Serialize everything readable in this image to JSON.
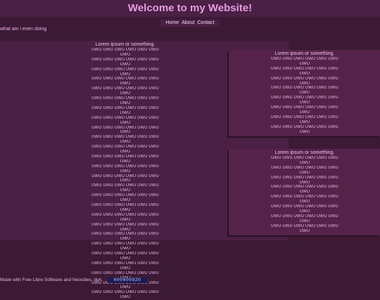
{
  "header": {
    "title": "Welcome to my Website!"
  },
  "nav": {
    "items": [
      "Home",
      "About",
      "Contact"
    ]
  },
  "subline": "what am i even doing",
  "main": {
    "title": "Lorem ipsum or something.",
    "rows": [
      "UWU UWU UWU UWU UWU UWU UWU",
      "UWU UWU UWU UWU UWU UWU UWU",
      "UWU UWU UWU UWU UWU UWU UWU",
      "UWU UWU UWU UWU UWU UWU UWU",
      "UWU UWU UWU UWU UWU UWU UWU",
      "UWU UWU UWU UWU UWU UWU UWU",
      "UWU UWU UWU UWU UWU UWU UWU",
      "UWU UWU UWU UWU UWU UWU UWU",
      "UWU UWU UWU UWU UWU UWU UWU",
      "UWU UWU UWU UWU UWU UWU UWU",
      "UWU UWU UWU UWU UWU UWU UWU",
      "UWU UWU UWU UWU UWU UWU UWU",
      "UWU UWU UWU UWU UWU UWU UWU",
      "UWU UWU UWU UWU UWU UWU UWU",
      "UWU UWU UWU UWU UWU UWU UWU",
      "UWU UWU UWU UWU UWU UWU UWU",
      "UWU UWU UWU UWU UWU UWU UWU",
      "UWU UWU UWU UWU UWU UWU UWU",
      "UWU UWU UWU UWU UWU UWU UWU",
      "UWU UWU UWU UWU UWU UWU UWU",
      "UWU UWU UWU UWU UWU UWU UWU",
      "UWU UWU UWU UWU UWU UWU UWU",
      "UWU UWU UWU UWU UWU UWU UWU",
      "UWU UWU UWU UWU UWU UWU UWU",
      "UWU UWU UWU UWU UWU UWU UWU",
      "UWU UWU UWU UWU UWU UWU UWU"
    ]
  },
  "side_top": {
    "title": "Lorem ipsum or something.",
    "rows": [
      "UWU UWU UWU UWU UWU UWU UWU",
      "UWU UWU UWU UWU UWU UWU UWU",
      "UWU UWU UWU UWU UWU UWU UWU",
      "UWU UWU UWU UWU UWU UWU UWU",
      "UWU UWU UWU UWU UWU UWU UWU",
      "UWU UWU UWU UWU UWU UWU UWU",
      "UWU UWU UWU UWU UWU UWU UWU",
      "UWU UWU UWU UWU UWU UWU UWU"
    ]
  },
  "side_bottom": {
    "title": "Lorem ipsum or something.",
    "rows": [
      "UWU UWU UWU UWU UWU UWU UWU",
      "UWU UWU UWU UWU UWU UWU UWU",
      "UWU UWU UWU UWU UWU UWU UWU",
      "UWU UWU UWU UWU UWU UWU UWU",
      "UWU UWU UWU UWU UWU UWU UWU",
      "UWU UWU UWU UWU UWU UWU UWU",
      "UWU UWU UWU UWU UWU UWU UWU",
      "UWU UWU UWU UWU UWU UWU UWU"
    ]
  },
  "footer": {
    "text": "Made with Free Libre Software and Neocities, duh.",
    "counter": "000000920"
  },
  "colors": {
    "background": "#3c1a35",
    "panel": "#4a2044",
    "side_panel": "#552249",
    "heading": "#e79be0",
    "counter_bg": "#1e1b52"
  }
}
